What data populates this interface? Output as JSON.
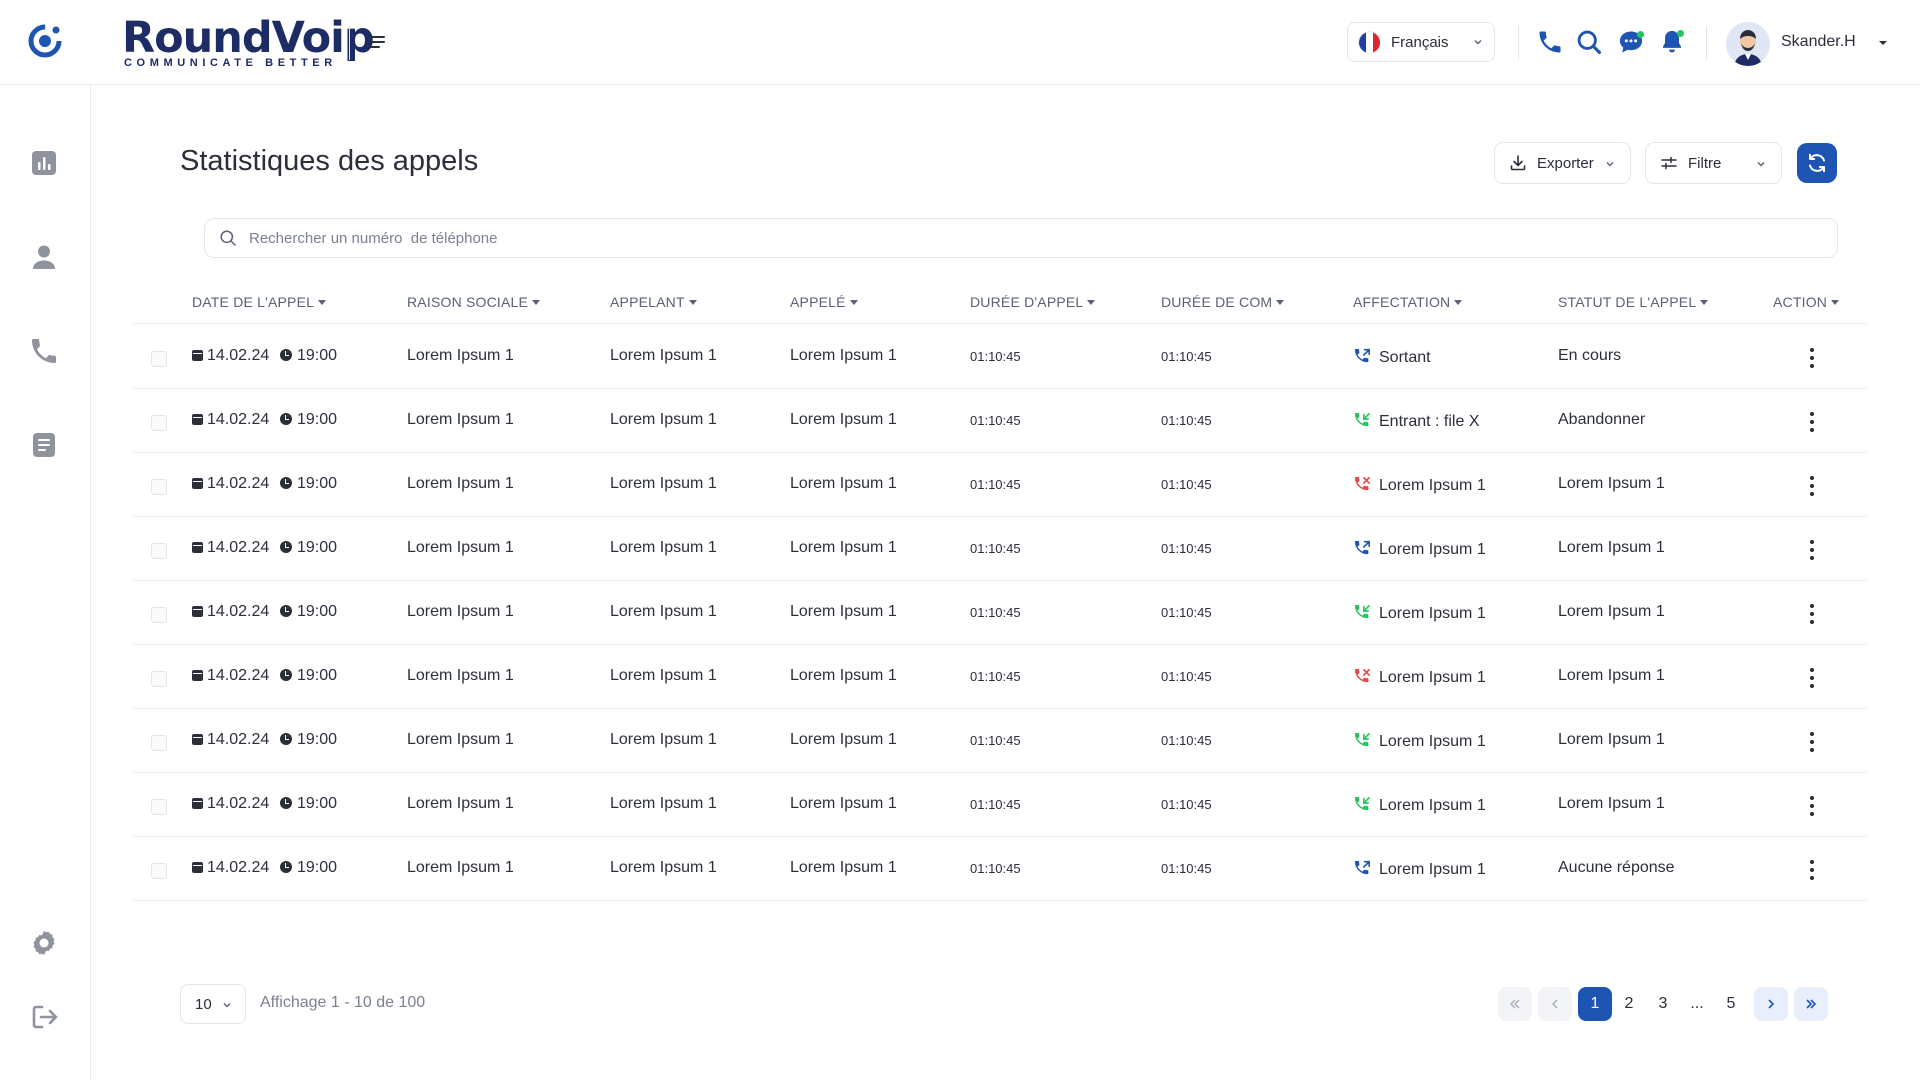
{
  "header": {
    "logo_main": "RoundVoip",
    "logo_sub": "COMMUNICATE BETTER",
    "language": "Français",
    "user_name": "Skander.H"
  },
  "page": {
    "title": "Statistiques des appels",
    "export_label": "Exporter",
    "filter_label": "Filtre",
    "search_placeholder": "Rechercher un numéro  de téléphone"
  },
  "table": {
    "columns": [
      "DATE DE L'APPEL",
      "RAISON SOCIALE",
      "APPELANT",
      "APPELÉ",
      "DURÉE D'APPEL",
      "DURÉE DE COM",
      "AFFECTATION",
      "STATUT DE L'APPEL",
      "ACTION"
    ],
    "rows": [
      {
        "date": "14.02.24",
        "time": "19:00",
        "raison": "Lorem Ipsum 1",
        "appelant": "Lorem Ipsum 1",
        "appele": "Lorem Ipsum 1",
        "duree_appel": "01:10:45",
        "duree_com": "01:10:45",
        "affectation": "Sortant",
        "aff_type": "outgoing",
        "statut": "En cours"
      },
      {
        "date": "14.02.24",
        "time": "19:00",
        "raison": "Lorem Ipsum 1",
        "appelant": "Lorem Ipsum 1",
        "appele": "Lorem Ipsum 1",
        "duree_appel": "01:10:45",
        "duree_com": "01:10:45",
        "affectation": "Entrant : file X",
        "aff_type": "incoming",
        "statut": "Abandonner"
      },
      {
        "date": "14.02.24",
        "time": "19:00",
        "raison": "Lorem Ipsum 1",
        "appelant": "Lorem Ipsum 1",
        "appele": "Lorem Ipsum 1",
        "duree_appel": "01:10:45",
        "duree_com": "01:10:45",
        "affectation": "Lorem Ipsum 1",
        "aff_type": "missed",
        "statut": "Lorem Ipsum 1"
      },
      {
        "date": "14.02.24",
        "time": "19:00",
        "raison": "Lorem Ipsum 1",
        "appelant": "Lorem Ipsum 1",
        "appele": "Lorem Ipsum 1",
        "duree_appel": "01:10:45",
        "duree_com": "01:10:45",
        "affectation": "Lorem Ipsum 1",
        "aff_type": "outgoing",
        "statut": "Lorem Ipsum 1"
      },
      {
        "date": "14.02.24",
        "time": "19:00",
        "raison": "Lorem Ipsum 1",
        "appelant": "Lorem Ipsum 1",
        "appele": "Lorem Ipsum 1",
        "duree_appel": "01:10:45",
        "duree_com": "01:10:45",
        "affectation": "Lorem Ipsum 1",
        "aff_type": "incoming",
        "statut": "Lorem Ipsum 1"
      },
      {
        "date": "14.02.24",
        "time": "19:00",
        "raison": "Lorem Ipsum 1",
        "appelant": "Lorem Ipsum 1",
        "appele": "Lorem Ipsum 1",
        "duree_appel": "01:10:45",
        "duree_com": "01:10:45",
        "affectation": "Lorem Ipsum 1",
        "aff_type": "missed",
        "statut": "Lorem Ipsum 1"
      },
      {
        "date": "14.02.24",
        "time": "19:00",
        "raison": "Lorem Ipsum 1",
        "appelant": "Lorem Ipsum 1",
        "appele": "Lorem Ipsum 1",
        "duree_appel": "01:10:45",
        "duree_com": "01:10:45",
        "affectation": "Lorem Ipsum 1",
        "aff_type": "incoming",
        "statut": "Lorem Ipsum 1"
      },
      {
        "date": "14.02.24",
        "time": "19:00",
        "raison": "Lorem Ipsum 1",
        "appelant": "Lorem Ipsum 1",
        "appele": "Lorem Ipsum 1",
        "duree_appel": "01:10:45",
        "duree_com": "01:10:45",
        "affectation": "Lorem Ipsum 1",
        "aff_type": "incoming",
        "statut": "Lorem Ipsum 1"
      },
      {
        "date": "14.02.24",
        "time": "19:00",
        "raison": "Lorem Ipsum 1",
        "appelant": "Lorem Ipsum 1",
        "appele": "Lorem Ipsum 1",
        "duree_appel": "01:10:45",
        "duree_com": "01:10:45",
        "affectation": "Lorem Ipsum 1",
        "aff_type": "outgoing",
        "statut": "Aucune réponse"
      }
    ]
  },
  "pagination": {
    "page_size": "10",
    "showing": "Affichage 1 - 10 de 100",
    "pages": [
      "1",
      "2",
      "3",
      "...",
      "5"
    ],
    "current": "1"
  },
  "icons": {
    "outgoing": "phone-outgoing-icon",
    "incoming": "phone-incoming-icon",
    "missed": "phone-missed-icon"
  },
  "colors": {
    "accent": "#1e55b3",
    "outgoing": "#1e55b3",
    "incoming": "#22c55e",
    "missed": "#ef4444",
    "brand": "#1e2c66"
  }
}
